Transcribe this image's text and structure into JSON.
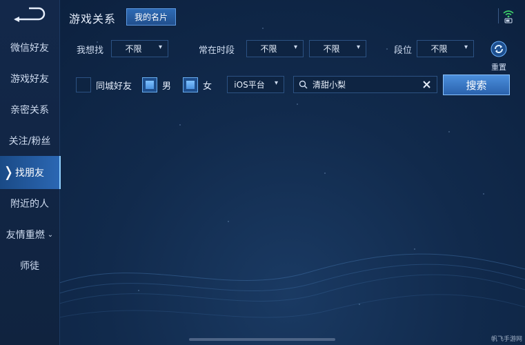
{
  "header": {
    "title": "游戏关系",
    "my_card_label": "我的名片"
  },
  "sidebar": {
    "items": [
      {
        "label": "微信好友"
      },
      {
        "label": "游戏好友"
      },
      {
        "label": "亲密关系"
      },
      {
        "label": "关注/粉丝"
      },
      {
        "label": "找朋友",
        "active": true
      },
      {
        "label": "附近的人"
      },
      {
        "label": "友情重燃",
        "expandable": true
      },
      {
        "label": "师徒"
      }
    ]
  },
  "filters": {
    "want_label": "我想找",
    "want_value": "不限",
    "online_time_label": "常在时段",
    "online_time_value_1": "不限",
    "online_time_value_2": "不限",
    "rank_label": "段位",
    "rank_value": "不限",
    "reset_label": "重置"
  },
  "options": {
    "same_city_label": "同城好友",
    "same_city_checked": false,
    "male_label": "男",
    "male_checked": true,
    "female_label": "女",
    "female_checked": true,
    "platform_value": "iOS平台"
  },
  "search": {
    "value": "清甜小梨",
    "button_label": "搜索"
  },
  "watermark": "帆飞手游网",
  "colors": {
    "accent": "#2b67b3",
    "background": "#112a4c",
    "wifi": "#3fd26a"
  }
}
